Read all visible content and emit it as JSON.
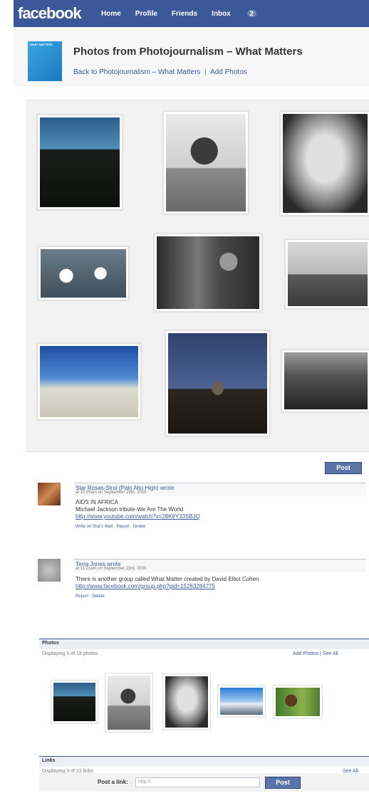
{
  "topbar": {
    "logo": "facebook",
    "nav": [
      "Home",
      "Profile",
      "Friends",
      "Inbox"
    ],
    "inbox_count": "2"
  },
  "header": {
    "group_thumb_text": "WHAT MATTERS",
    "title": "Photos from Photojournalism – What Matters",
    "back_link": "Back to Photojournalism – What Matters",
    "add_photos": "Add Photos"
  },
  "wall": {
    "post_button": "Post",
    "posts": [
      {
        "author": "Star Rosas-Strul (Palo Alto High) wrote",
        "time": "at 10:05am on September 29th, 2009",
        "lines": [
          "AIDS IN AFRICA",
          "Michael Jackson tribute-We Are The World"
        ],
        "link": "http://www.youtube.com/watch?v=28K9Y33SBJQ",
        "actions": "Write on Star's Wall · Report · Delete"
      },
      {
        "author": "Terra Jones wrote",
        "time": "at 11:21am on September 23rd, 2009",
        "lines": [
          "There is another group called What Matter created by David Elliot Cohen"
        ],
        "link": "http://www.facebook.com/group.php?gid=15263284775",
        "actions": "Report · Delete"
      }
    ]
  },
  "photos_box": {
    "title": "Photos",
    "subtitle": "Displaying 5 of 19 photos",
    "links": "Add Photos | See All"
  },
  "links_box": {
    "title": "Links",
    "subtitle": "Displaying 3 of 23 links",
    "see_all": "See All",
    "post_label": "Post a link:",
    "input_placeholder": "http://",
    "post_button": "Post"
  },
  "colors": {
    "brand": "#3b5998",
    "brand_light": "#6d84b4",
    "button": "#5b74a8",
    "group_thumb": "#2a8fd4"
  }
}
